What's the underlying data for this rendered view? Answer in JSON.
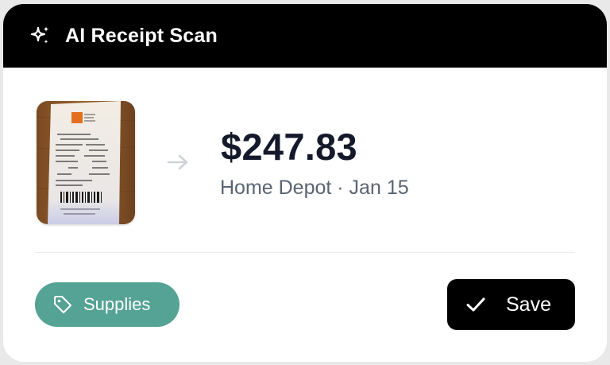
{
  "header": {
    "title": "AI Receipt Scan",
    "icon": "sparkles-icon"
  },
  "receipt": {
    "thumbnail_icon": "receipt-photo",
    "amount": "$247.83",
    "meta": "Home Depot · Jan 15"
  },
  "category": {
    "label": "Supplies",
    "icon": "tag-icon",
    "color": "#54a395"
  },
  "actions": {
    "save_label": "Save",
    "save_icon": "check-icon"
  },
  "colors": {
    "header_bg": "#000000",
    "amount_text": "#141a2b",
    "meta_text": "#5a6472"
  }
}
